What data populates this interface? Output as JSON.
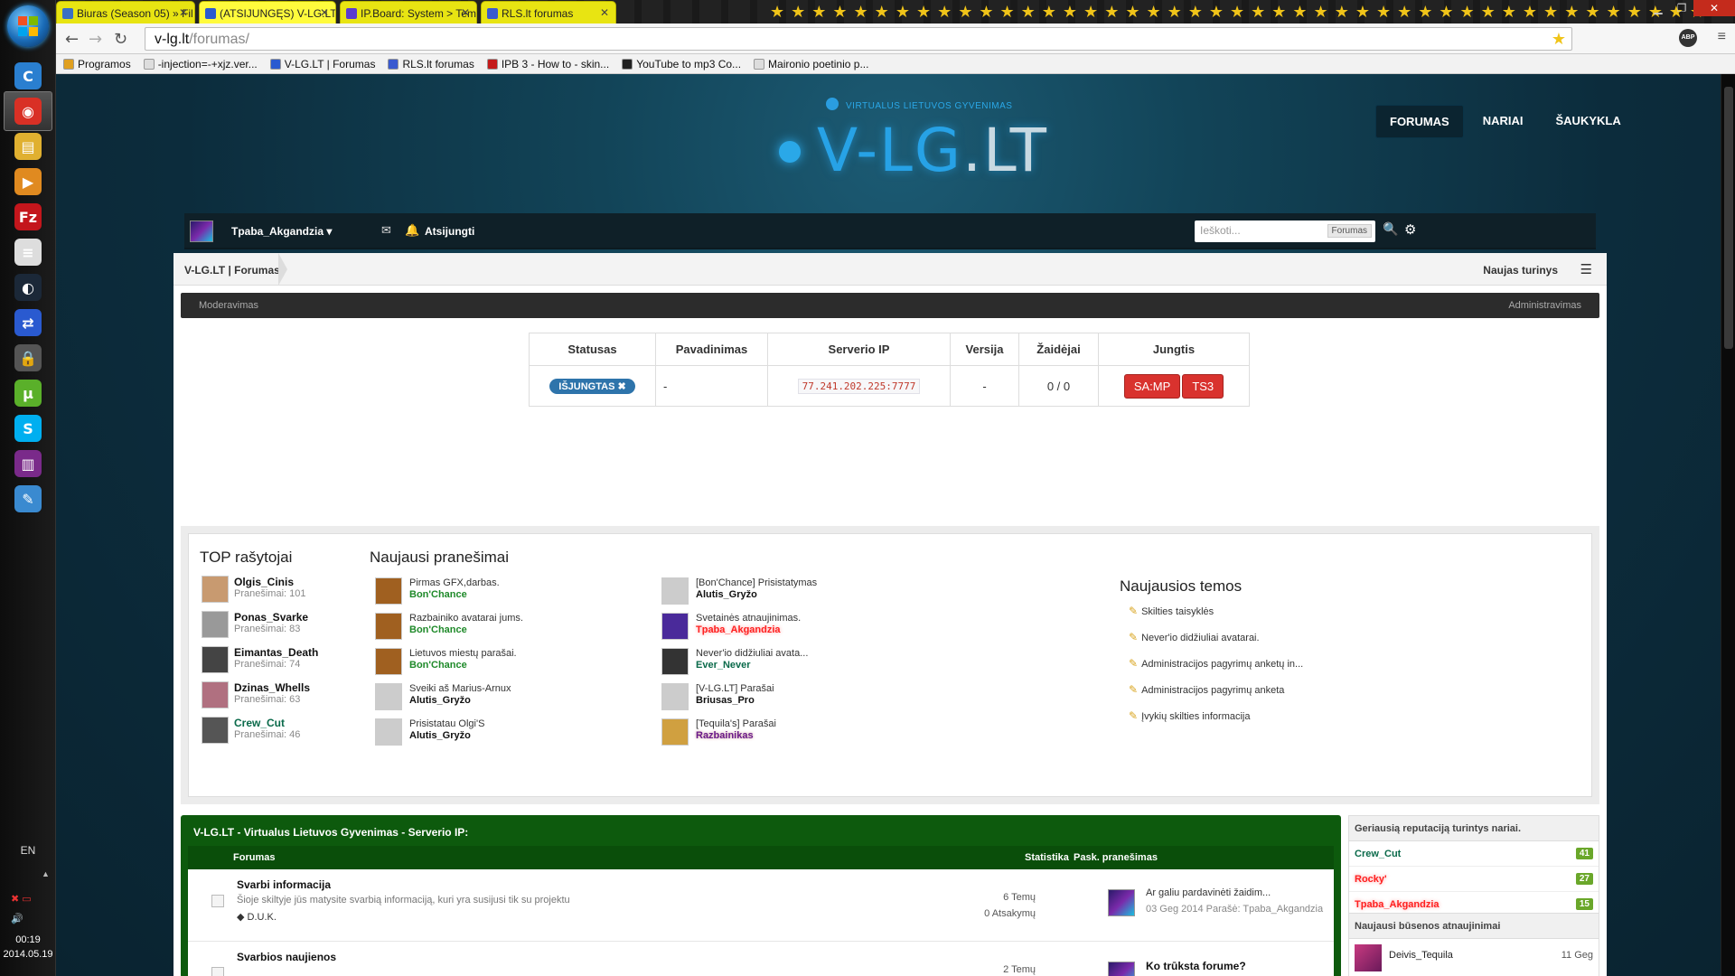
{
  "taskbar": {
    "apps": [
      {
        "name": "ccleaner-icon",
        "color": "#2a7fd0",
        "glyph": "C"
      },
      {
        "name": "chrome-icon",
        "color": "#d93025",
        "glyph": "◉",
        "active": true
      },
      {
        "name": "file-explorer-icon",
        "color": "#e0b030",
        "glyph": "▤"
      },
      {
        "name": "media-player-icon",
        "color": "#e08a20",
        "glyph": "▶"
      },
      {
        "name": "filezilla-icon",
        "color": "#c4161c",
        "glyph": "Fz"
      },
      {
        "name": "notepad-icon",
        "color": "#ddd",
        "glyph": "≡"
      },
      {
        "name": "steam-icon",
        "color": "#1b2838",
        "glyph": "◐"
      },
      {
        "name": "network-icon",
        "color": "#2a5ad0",
        "glyph": "⇄"
      },
      {
        "name": "lock-icon",
        "color": "#555",
        "glyph": "🔒"
      },
      {
        "name": "utorrent-icon",
        "color": "#5ab02a",
        "glyph": "µ"
      },
      {
        "name": "skype-icon",
        "color": "#00aff0",
        "glyph": "S"
      },
      {
        "name": "winrar-icon",
        "color": "#7a2a8a",
        "glyph": "▥"
      },
      {
        "name": "paint-icon",
        "color": "#3a8ad0",
        "glyph": "✎"
      }
    ],
    "language": "EN",
    "time": "00:19",
    "date": "2014.05.19"
  },
  "browser": {
    "tabs": [
      {
        "title": "Biuras (Season 05) » Fil",
        "fav": "#3b70c4"
      },
      {
        "title": "(ATSIJUNGĘS) V-LG.LT | Fo",
        "fav": "#2a5ad0",
        "active": true
      },
      {
        "title": "IP.Board: System > Temų",
        "fav": "#5a3ad0"
      },
      {
        "title": "RLS.lt forumas",
        "fav": "#3a5ad0"
      }
    ],
    "url_host": "v-lg.lt",
    "url_path": "/forumas/",
    "bookmarks": [
      {
        "label": "Programos",
        "color": "#e0a020"
      },
      {
        "label": "-injection=-+xjz.ver...",
        "color": "#ddd"
      },
      {
        "label": "V-LG.LT | Forumas",
        "color": "#2a5ad0"
      },
      {
        "label": "RLS.lt forumas",
        "color": "#3a5ad0"
      },
      {
        "label": "IPB 3 - How to - skin...",
        "color": "#c41a1a"
      },
      {
        "label": "YouTube to mp3 Co...",
        "color": "#222"
      },
      {
        "label": "Maironio poetinio p...",
        "color": "#ddd"
      }
    ]
  },
  "site": {
    "tagline": "VIRTUALUS LIETUVOS GYVENIMAS",
    "logo_main": "V-LG",
    "logo_tld": ".LT",
    "nav": [
      "FORUMAS",
      "NARIAI",
      "ŠAUKYKLA"
    ]
  },
  "userbar": {
    "username": "Tpaba_Akgandzia",
    "logout": "Atsijungti",
    "search_placeholder": "Ieškoti...",
    "search_scope": "Forumas"
  },
  "breadcrumb": {
    "home": "V-LG.LT | Forumas",
    "new_content": "Naujas turinys"
  },
  "modbar": {
    "left": "Moderavimas",
    "right": "Administravimas"
  },
  "server": {
    "headers": [
      "Statusas",
      "Pavadinimas",
      "Serverio IP",
      "Versija",
      "Žaidėjai",
      "Jungtis"
    ],
    "status": "IŠJUNGTAS ✖",
    "name": "-",
    "ip": "77.241.202.225:7777",
    "version": "-",
    "players": "0 / 0",
    "btn_samp": "SA:MP",
    "btn_ts3": "TS3"
  },
  "top_posters": {
    "title": "TOP rašytojai",
    "items": [
      {
        "name": "Olgis_Cinis",
        "count": "Pranešimai: 101",
        "color": "#c89a70"
      },
      {
        "name": "Ponas_Svarke",
        "count": "Pranešimai: 83",
        "color": "#999"
      },
      {
        "name": "Eimantas_Death",
        "count": "Pranešimai: 74",
        "color": "#444"
      },
      {
        "name": "Dzinas_Whells",
        "count": "Pranešimai: 63",
        "color": "#b07080"
      },
      {
        "name": "Crew_Cut",
        "count": "Pranešimai: 46",
        "color": "#555"
      }
    ]
  },
  "recent_posts": {
    "title": "Naujausi pranešimai",
    "left": [
      {
        "topic": "Pirmas GFX,darbas.",
        "author": "Bon'Chance",
        "cls": "green-name",
        "color": "#a06020"
      },
      {
        "topic": "Razbainiko avatarai jums.",
        "author": "Bon'Chance",
        "cls": "green-name",
        "color": "#a06020"
      },
      {
        "topic": "Lietuvos miestų parašai.",
        "author": "Bon'Chance",
        "cls": "green-name",
        "color": "#a06020"
      },
      {
        "topic": "Sveiki aš Marius-Arnux",
        "author": "Alutis_Gryžo",
        "cls": "",
        "color": "#ccc"
      },
      {
        "topic": "Prisistatau Olgi'S",
        "author": "Alutis_Gryžo",
        "cls": "",
        "color": "#ccc"
      }
    ],
    "right": [
      {
        "topic": "[Bon'Chance] Prisistatymas",
        "author": "Alutis_Gryžo",
        "cls": "",
        "color": "#ccc"
      },
      {
        "topic": "Svetainės atnaujinimas.",
        "author": "Tpaba_Akgandzia",
        "cls": "red-name",
        "color": "#4a2a9a"
      },
      {
        "topic": "Never'io didžiuliai avata...",
        "author": "Ever_Never",
        "cls": "teal-name",
        "color": "#333"
      },
      {
        "topic": "[V-LG.LT] Parašai",
        "author": "Briusas_Pro",
        "cls": "",
        "color": "#ccc"
      },
      {
        "topic": "[Tequila's] Parašai",
        "author": "Razbainikas",
        "cls": "purple-name",
        "color": "#d0a040"
      }
    ]
  },
  "latest_topics": {
    "title": "Naujausios temos",
    "items": [
      "Skilties taisyklės",
      "Never'io didžiuliai avatarai.",
      "Administracijos pagyrimų anketų in...",
      "Administracijos pagyrimų anketa",
      "Įvykių skilties informacija"
    ]
  },
  "forum": {
    "title": "V-LG.LT - Virtualus Lietuvos Gyvenimas - Serverio IP:",
    "col_forum": "Forumas",
    "col_stats": "Statistika",
    "col_last": "Pask. pranešimas",
    "rows": [
      {
        "name": "Svarbi informacija",
        "desc": "Šioje skiltyje jūs matysite svarbią informaciją, kuri yra susijusi tik su projektu",
        "sub": "◆ D.U.K.",
        "topics": "6 Temų",
        "replies": "0 Atsakymų",
        "last_title": "Ar galiu pardavinėti žaidim...",
        "last_meta": "03 Geg 2014 Parašė: Tpaba_Akgandzia"
      },
      {
        "name": "Svarbios naujienos",
        "desc": "",
        "sub": "",
        "topics": "2 Temų",
        "replies": "",
        "last_title": "Ko trūksta forume?",
        "last_meta": ""
      }
    ]
  },
  "reputation": {
    "title": "Geriausią reputaciją turintys nariai.",
    "items": [
      {
        "name": "Crew_Cut",
        "value": "41",
        "cls": "teal-name"
      },
      {
        "name": "Rocky'",
        "value": "27",
        "cls": "red-name"
      },
      {
        "name": "Tpaba_Akgandzia",
        "value": "15",
        "cls": "red-name"
      }
    ]
  },
  "status_updates": {
    "title": "Naujausi būsenos atnaujinimai",
    "first_user": "Deivis_Tequila",
    "first_date": "11 Geg"
  }
}
